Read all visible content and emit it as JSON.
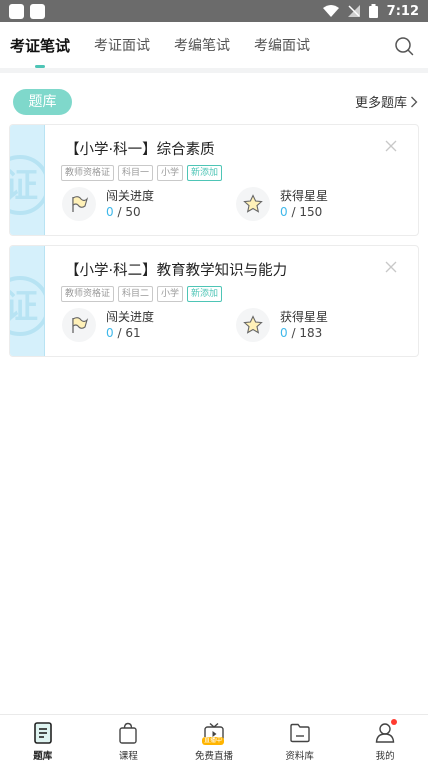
{
  "status_bar": {
    "time": "7:12"
  },
  "top_tabs": [
    {
      "label": "考证笔试",
      "active": true
    },
    {
      "label": "考证面试",
      "active": false
    },
    {
      "label": "考编笔试",
      "active": false
    },
    {
      "label": "考编面试",
      "active": false
    }
  ],
  "section": {
    "pill_label": "题库",
    "more_label": "更多题库"
  },
  "cards": [
    {
      "side_mark": "证",
      "title": "【小学·科一】综合素质",
      "tags": [
        "教师资格证",
        "科目一",
        "小学",
        "新添加"
      ],
      "progress": {
        "label": "闯关进度",
        "current": "0",
        "total": "/ 50"
      },
      "stars": {
        "label": "获得星星",
        "current": "0",
        "total": "/ 150"
      }
    },
    {
      "side_mark": "证",
      "title": "【小学·科二】教育教学知识与能力",
      "tags": [
        "教师资格证",
        "科目二",
        "小学",
        "新添加"
      ],
      "progress": {
        "label": "闯关进度",
        "current": "0",
        "total": "/ 61"
      },
      "stars": {
        "label": "获得星星",
        "current": "0",
        "total": "/ 183"
      }
    }
  ],
  "bottom_nav": [
    {
      "label": "题库",
      "icon": "question-bank-icon",
      "active": true
    },
    {
      "label": "课程",
      "icon": "course-bag-icon",
      "active": false
    },
    {
      "label": "免费直播",
      "icon": "live-tv-icon",
      "active": false,
      "badge": "直播中"
    },
    {
      "label": "资料库",
      "icon": "folder-icon",
      "active": false
    },
    {
      "label": "我的",
      "icon": "profile-icon",
      "active": false,
      "dot": true
    }
  ],
  "colors": {
    "accent": "#4ec5b6",
    "pill": "#7fd8cb",
    "value_blue": "#3fb8ea",
    "card_side": "#d5f0fb"
  }
}
